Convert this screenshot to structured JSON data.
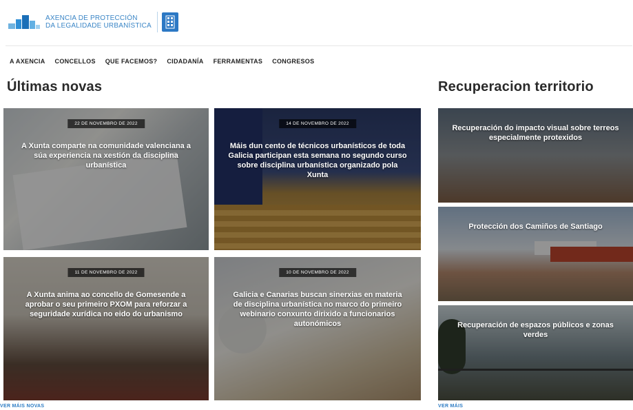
{
  "header": {
    "logo_line1": "AXENCIA DE PROTECCIÓN",
    "logo_line2": "DA LEGALIDADE URBANÍSTICA"
  },
  "nav": {
    "items": [
      {
        "label": "A AXENCIA"
      },
      {
        "label": "CONCELLOS"
      },
      {
        "label": "QUE FACEMOS?"
      },
      {
        "label": "CIDADANÍA"
      },
      {
        "label": "FERRAMENTAS"
      },
      {
        "label": "CONGRESOS"
      }
    ]
  },
  "news": {
    "title": "Últimas novas",
    "more_label": "VER MÁIS NOVAS",
    "cards": [
      {
        "date": "22 DE NOVEMBRO DE 2022",
        "title": "A Xunta comparte na comunidade valenciana a súa experiencia na xestión da disciplina urbanística"
      },
      {
        "date": "14 DE NOVEMBRO DE 2022",
        "title": "Máis dun cento de técnicos urbanísticos de toda Galicia participan esta semana no segundo curso sobre disciplina urbanística organizado pola Xunta"
      },
      {
        "date": "11 DE NOVEMBRO DE 2022",
        "title": "A Xunta anima ao concello de Gomesende a aprobar o seu primeiro PXOM para reforzar a seguridade xurídica no eido do urbanismo"
      },
      {
        "date": "10 DE NOVEMBRO DE 2022",
        "title": "Galicia e Canarias buscan sinerxias en materia de disciplina urbanística no marco do primeiro webinario conxunto dirixido a funcionarios autonómicos"
      }
    ]
  },
  "recovery": {
    "title": "Recuperacion territorio",
    "more_label": "VER MÁIS",
    "cards": [
      {
        "title": "Recuperación do impacto visual sobre terreos especialmente protexidos"
      },
      {
        "title": "Protección dos Camiños de Santiago"
      },
      {
        "title": "Recuperación de espazos públicos e zonas verdes"
      }
    ]
  },
  "colors": {
    "brand_blue": "#2c78c4",
    "link_blue": "#2d7cc4"
  }
}
